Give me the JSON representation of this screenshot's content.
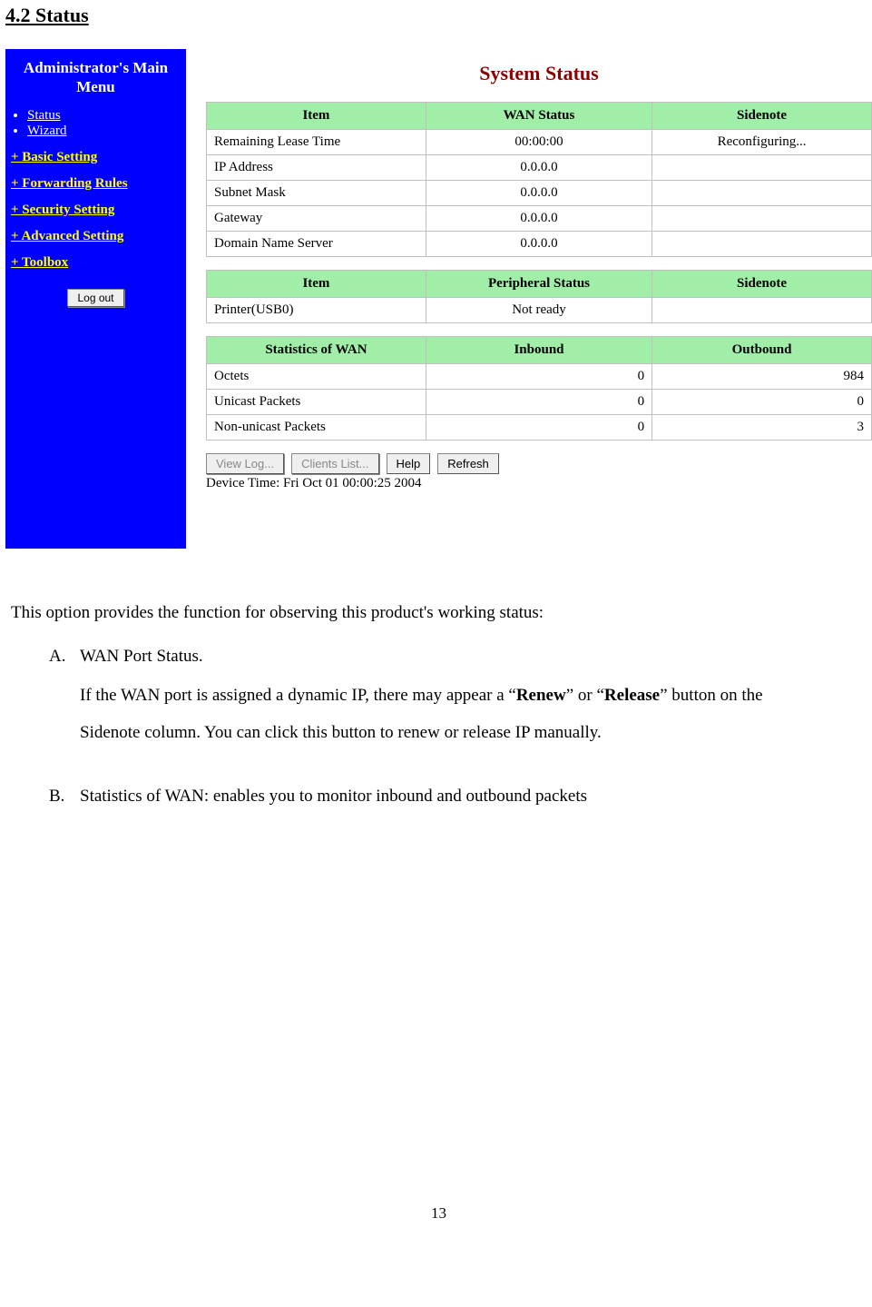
{
  "heading": "4.2 Status",
  "sidebar": {
    "title_l1": "Administrator's Main",
    "title_l2": "Menu",
    "bullets": [
      "Status",
      "Wizard"
    ],
    "links": [
      "+ Basic Setting",
      "+ Forwarding Rules",
      "+ Security Setting",
      "+ Advanced Setting",
      "+ Toolbox"
    ],
    "logout": "Log out"
  },
  "main": {
    "title": "System Status",
    "table1": {
      "headers": [
        "Item",
        "WAN Status",
        "Sidenote"
      ],
      "rows": [
        {
          "item": "Remaining Lease Time",
          "val": "00:00:00",
          "note": "Reconfiguring..."
        },
        {
          "item": "IP Address",
          "val": "0.0.0.0",
          "note": ""
        },
        {
          "item": "Subnet Mask",
          "val": "0.0.0.0",
          "note": ""
        },
        {
          "item": "Gateway",
          "val": "0.0.0.0",
          "note": ""
        },
        {
          "item": "Domain Name Server",
          "val": "0.0.0.0",
          "note": ""
        }
      ]
    },
    "table2": {
      "headers": [
        "Item",
        "Peripheral Status",
        "Sidenote"
      ],
      "rows": [
        {
          "item": "Printer(USB0)",
          "val": "Not ready",
          "note": ""
        }
      ]
    },
    "table3": {
      "headers": [
        "Statistics of WAN",
        "Inbound",
        "Outbound"
      ],
      "rows": [
        {
          "item": "Octets",
          "in": "0",
          "out": "984"
        },
        {
          "item": "Unicast Packets",
          "in": "0",
          "out": "0"
        },
        {
          "item": "Non-unicast Packets",
          "in": "0",
          "out": "3"
        }
      ]
    },
    "buttons": {
      "viewlog": "View Log...",
      "clients": "Clients List...",
      "help": "Help",
      "refresh": "Refresh"
    },
    "device_time": "Device Time: Fri Oct 01 00:00:25 2004"
  },
  "desc": {
    "intro": "This option provides the function for observing this product's working status:",
    "a_letter": "A.",
    "a_head": "WAN Port Status.",
    "a_body_1": "If the WAN port is assigned a dynamic IP, there may appear a “",
    "a_body_bold1": "Renew",
    "a_body_2": "” or “",
    "a_body_bold2": "Release",
    "a_body_3": "” button on the Sidenote column. You can click this button to renew or release IP manually.",
    "b_letter": "B.",
    "b_text": "Statistics of WAN: enables you to monitor inbound and outbound packets"
  },
  "page_number": "13"
}
